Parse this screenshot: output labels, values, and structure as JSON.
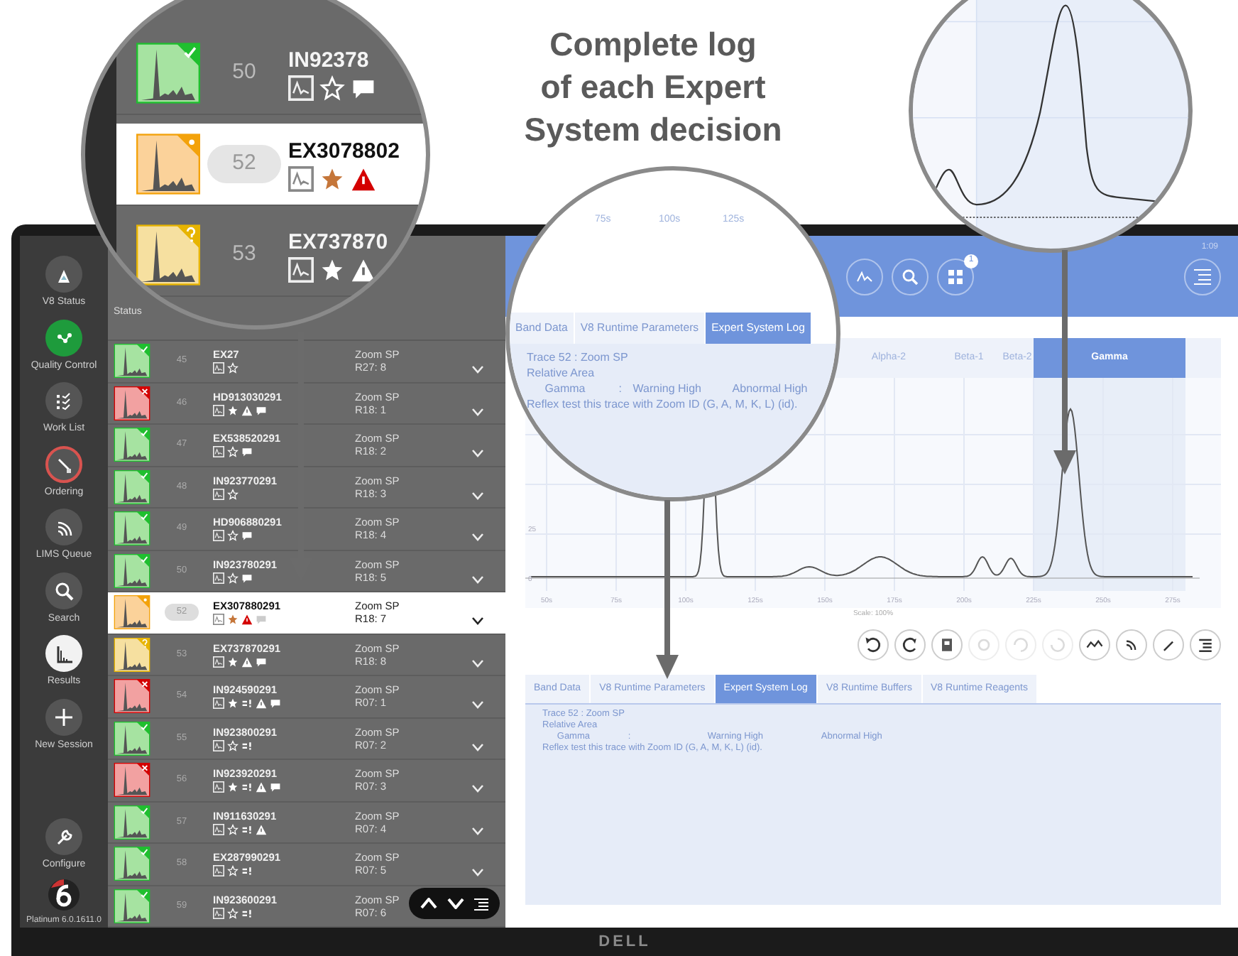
{
  "headline": "Complete log\nof each Expert\nSystem decision",
  "nav": [
    {
      "label": "V8 Status",
      "selected": false
    },
    {
      "label": "Quality Control",
      "selected": false,
      "color": "#1e9b3c"
    },
    {
      "label": "Work List",
      "selected": false
    },
    {
      "label": "Ordering",
      "selected": false,
      "color": "#d9534f"
    },
    {
      "label": "LIMS Queue",
      "selected": false
    },
    {
      "label": "Search",
      "selected": false
    },
    {
      "label": "Results",
      "selected": true
    },
    {
      "label": "New Session",
      "selected": false
    },
    {
      "label": "Configure",
      "selected": false
    }
  ],
  "version": "Platinum 6.0.1611.0",
  "list": {
    "header": "Status",
    "rows": [
      {
        "number": "45",
        "id": "EX27",
        "test": "Zoom SP",
        "ref": "R27: 8",
        "kind": "pass",
        "selected": false,
        "flags": [
          {
            "kind": "trace"
          },
          {
            "kind": "star"
          }
        ]
      },
      {
        "number": "46",
        "id": "HD913030291",
        "test": "Zoom SP",
        "ref": "R18: 1",
        "kind": "fail",
        "selected": false,
        "flags": [
          {
            "kind": "trace"
          },
          {
            "kind": "star-filled"
          },
          {
            "kind": "warning"
          },
          {
            "kind": "comment"
          }
        ]
      },
      {
        "number": "47",
        "id": "EX538520291",
        "test": "Zoom SP",
        "ref": "R18: 2",
        "kind": "pass",
        "selected": false,
        "flags": [
          {
            "kind": "trace"
          },
          {
            "kind": "star"
          },
          {
            "kind": "comment"
          }
        ]
      },
      {
        "number": "48",
        "id": "IN923770291",
        "test": "Zoom SP",
        "ref": "R18: 3",
        "kind": "pass",
        "selected": false,
        "flags": [
          {
            "kind": "trace"
          },
          {
            "kind": "star"
          }
        ]
      },
      {
        "number": "49",
        "id": "HD906880291",
        "test": "Zoom SP",
        "ref": "R18: 4",
        "kind": "pass",
        "selected": false,
        "flags": [
          {
            "kind": "trace"
          },
          {
            "kind": "star"
          },
          {
            "kind": "comment"
          }
        ]
      },
      {
        "number": "50",
        "id": "IN923780291",
        "test": "Zoom SP",
        "ref": "R18: 5",
        "kind": "pass",
        "selected": false,
        "flags": [
          {
            "kind": "trace"
          },
          {
            "kind": "star"
          },
          {
            "kind": "comment"
          }
        ]
      },
      {
        "number": "52",
        "id": "EX307880291",
        "test": "Zoom SP",
        "ref": "R18: 7",
        "kind": "flagged",
        "selected": true,
        "flags": [
          {
            "kind": "trace"
          },
          {
            "kind": "star-filled"
          },
          {
            "kind": "warning"
          },
          {
            "kind": "comment"
          }
        ]
      },
      {
        "number": "53",
        "id": "EX737870291",
        "test": "Zoom SP",
        "ref": "R18: 8",
        "kind": "review",
        "selected": false,
        "flags": [
          {
            "kind": "trace"
          },
          {
            "kind": "star-filled"
          },
          {
            "kind": "warning"
          },
          {
            "kind": "comment"
          }
        ]
      },
      {
        "number": "54",
        "id": "IN924590291",
        "test": "Zoom SP",
        "ref": "R07: 1",
        "kind": "fail",
        "selected": false,
        "flags": [
          {
            "kind": "trace"
          },
          {
            "kind": "star-filled"
          },
          {
            "kind": "bars"
          },
          {
            "kind": "warning"
          },
          {
            "kind": "comment"
          }
        ]
      },
      {
        "number": "55",
        "id": "IN923800291",
        "test": "Zoom SP",
        "ref": "R07: 2",
        "kind": "pass",
        "selected": false,
        "flags": [
          {
            "kind": "trace"
          },
          {
            "kind": "star"
          },
          {
            "kind": "bars"
          }
        ]
      },
      {
        "number": "56",
        "id": "IN923920291",
        "test": "Zoom SP",
        "ref": "R07: 3",
        "kind": "fail",
        "selected": false,
        "flags": [
          {
            "kind": "trace"
          },
          {
            "kind": "star-filled"
          },
          {
            "kind": "bars"
          },
          {
            "kind": "warning"
          },
          {
            "kind": "comment"
          }
        ]
      },
      {
        "number": "57",
        "id": "IN911630291",
        "test": "Zoom SP",
        "ref": "R07: 4",
        "kind": "pass",
        "selected": false,
        "flags": [
          {
            "kind": "trace"
          },
          {
            "kind": "star"
          },
          {
            "kind": "bars"
          },
          {
            "kind": "warning"
          }
        ]
      },
      {
        "number": "58",
        "id": "EX287990291",
        "test": "Zoom SP",
        "ref": "R07: 5",
        "kind": "pass",
        "selected": false,
        "flags": [
          {
            "kind": "trace"
          },
          {
            "kind": "star"
          },
          {
            "kind": "bars"
          }
        ]
      },
      {
        "number": "59",
        "id": "IN923600291",
        "test": "Zoom SP",
        "ref": "R07: 6",
        "kind": "pass",
        "selected": false,
        "flags": [
          {
            "kind": "trace"
          },
          {
            "kind": "star"
          },
          {
            "kind": "bars"
          }
        ]
      }
    ]
  },
  "magnifier_list": {
    "rows": [
      {
        "number": "50",
        "id": "IN92378",
        "kind": "pass",
        "selected": false,
        "flags": [
          {
            "kind": "trace"
          },
          {
            "kind": "star"
          },
          {
            "kind": "comment"
          }
        ]
      },
      {
        "number": "52",
        "id": "EX3078802",
        "kind": "flagged",
        "selected": true,
        "flags": [
          {
            "kind": "trace"
          },
          {
            "kind": "star-filled"
          },
          {
            "kind": "warning"
          }
        ]
      },
      {
        "number": "53",
        "id": "EX737870",
        "kind": "review",
        "selected": false,
        "flags": [
          {
            "kind": "trace"
          },
          {
            "kind": "star-filled"
          },
          {
            "kind": "warning"
          }
        ]
      }
    ]
  },
  "header": {
    "badge": "1",
    "clock": "1:09"
  },
  "bands": [
    {
      "label": "Alpha-2",
      "selected": false
    },
    {
      "label": "Beta-1",
      "selected": false
    },
    {
      "label": "Beta-2",
      "selected": false
    },
    {
      "label": "Gamma",
      "selected": true
    }
  ],
  "trace": {
    "x_ticks": [
      "50s",
      "75s",
      "100s",
      "125s",
      "150s",
      "175s",
      "200s",
      "225s",
      "250s",
      "275s"
    ],
    "y_ticks": [
      "25",
      "0"
    ],
    "scale": "Scale: 100%"
  },
  "tools": [
    {
      "disabled": false
    },
    {
      "disabled": false
    },
    {
      "disabled": false
    },
    {
      "disabled": true
    },
    {
      "disabled": true
    },
    {
      "disabled": true
    },
    {
      "disabled": false
    },
    {
      "disabled": false
    },
    {
      "disabled": false
    },
    {
      "disabled": false
    }
  ],
  "tabs": [
    {
      "label": "Band Data",
      "selected": false
    },
    {
      "label": "V8 Runtime Parameters",
      "selected": false
    },
    {
      "label": "Expert System Log",
      "selected": true
    },
    {
      "label": "V8 Runtime Buffers",
      "selected": false
    },
    {
      "label": "V8 Runtime Reagents",
      "selected": false
    }
  ],
  "log": [
    {
      "kind": "text",
      "text": "Trace  52 : Zoom SP"
    },
    {
      "kind": "text",
      "text": "Relative Area"
    },
    {
      "kind": "columns",
      "cells": [
        "Gamma",
        ":",
        "Warning High",
        "Abnormal High"
      ]
    },
    {
      "kind": "text",
      "text": "Reflex test this trace with Zoom ID (G, A, M, K, L) (id)."
    }
  ],
  "magnifier_log": {
    "ticks": [
      "75s",
      "100s",
      "125s"
    ],
    "tabs": [
      {
        "label": "Band Data",
        "selected": false
      },
      {
        "label": "V8 Runtime Parameters",
        "selected": false
      },
      {
        "label": "Expert System Log",
        "selected": true
      }
    ],
    "log": [
      {
        "kind": "text",
        "text": "Trace  52 : Zoom SP"
      },
      {
        "kind": "text",
        "text": "Relative Area"
      },
      {
        "kind": "columns",
        "cells": [
          "Gamma",
          ":",
          "Warning High",
          "Abnormal High"
        ]
      },
      {
        "kind": "text",
        "text": "Reflex test this trace with Zoom ID (G, A, M, K, L) (id)."
      }
    ]
  },
  "bezel_logo": "DELL"
}
